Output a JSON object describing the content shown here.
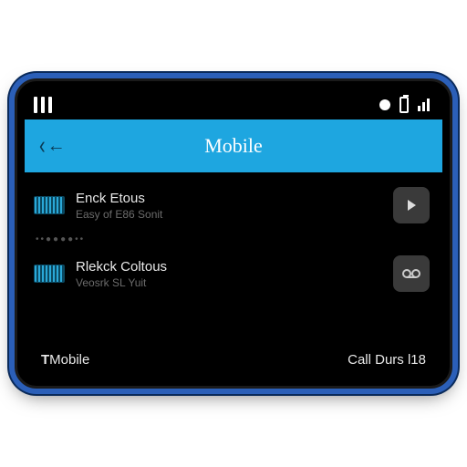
{
  "header": {
    "title": "Mobile"
  },
  "list": {
    "items": [
      {
        "primary": "Enck Etous",
        "secondary": "Easy of E86 Sonit",
        "action_icon": "play-icon"
      },
      {
        "primary": "Rlekck Coltous",
        "secondary": "Veosrk SL Yuit",
        "action_icon": "voicemail-icon"
      }
    ],
    "divider": "••●●●●••"
  },
  "footer": {
    "brand_bold": "T",
    "brand_rest": "Mobile",
    "right": "Call Durs l18"
  }
}
